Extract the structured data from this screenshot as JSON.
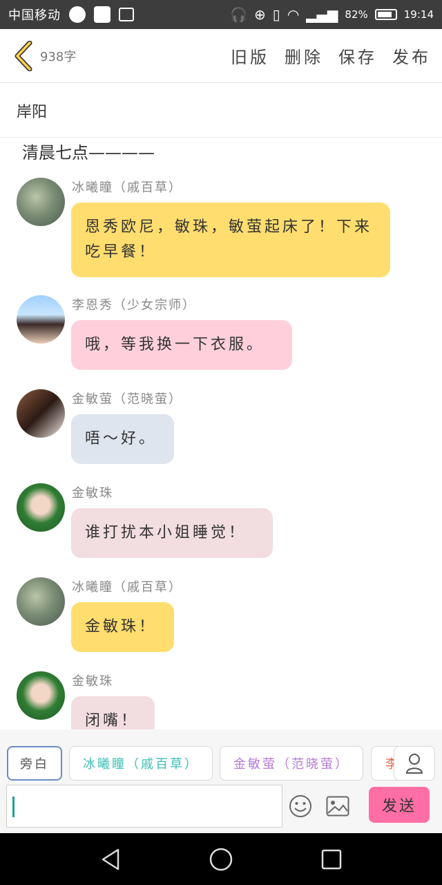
{
  "status_bar": {
    "carrier": "中国移动",
    "battery": "82%",
    "time": "19:14"
  },
  "topnav": {
    "word_count": "938字",
    "actions": [
      "旧版",
      "删除",
      "保存",
      "发布"
    ]
  },
  "story": {
    "title": "岸阳",
    "narration": "清晨七点————"
  },
  "messages": [
    {
      "name": "冰曦瞳（戚百草）",
      "text": "恩秀欧尼，敏珠，敏萤起床了！下来吃早餐！",
      "avatar": "avatar-bingxitong"
    },
    {
      "name": "李恩秀（少女宗师）",
      "text": "哦，等我换一下衣服。",
      "avatar": "avatar-lienxiu"
    },
    {
      "name": "金敏萤（范晓萤）",
      "text": "唔～好。",
      "avatar": "avatar-jinminying"
    },
    {
      "name": "金敏珠",
      "text": "谁打扰本小姐睡觉！",
      "avatar": "avatar-jinminzhu"
    },
    {
      "name": "冰曦瞳（戚百草）",
      "text": "金敏珠！",
      "avatar": "avatar-bingxitong"
    },
    {
      "name": "金敏珠",
      "text": "闭嘴！",
      "avatar": "avatar-jinminzhu"
    }
  ],
  "composer": {
    "roles": [
      "旁白",
      "冰曦瞳（戚百草）",
      "金敏萤（范晓萤）",
      "李"
    ],
    "role_colors": [
      "#555555",
      "#3bbfb5",
      "#b57ad6",
      "#e8664a"
    ],
    "input_value": "",
    "send_label": "发送"
  },
  "colors": {
    "accent": "#ff6fa5",
    "yellow_bubble": "#ffdd6e",
    "pink_bubble": "#ffd0dc",
    "blue_bubble": "#dfe5ee",
    "rose_bubble": "#f2dde1"
  }
}
